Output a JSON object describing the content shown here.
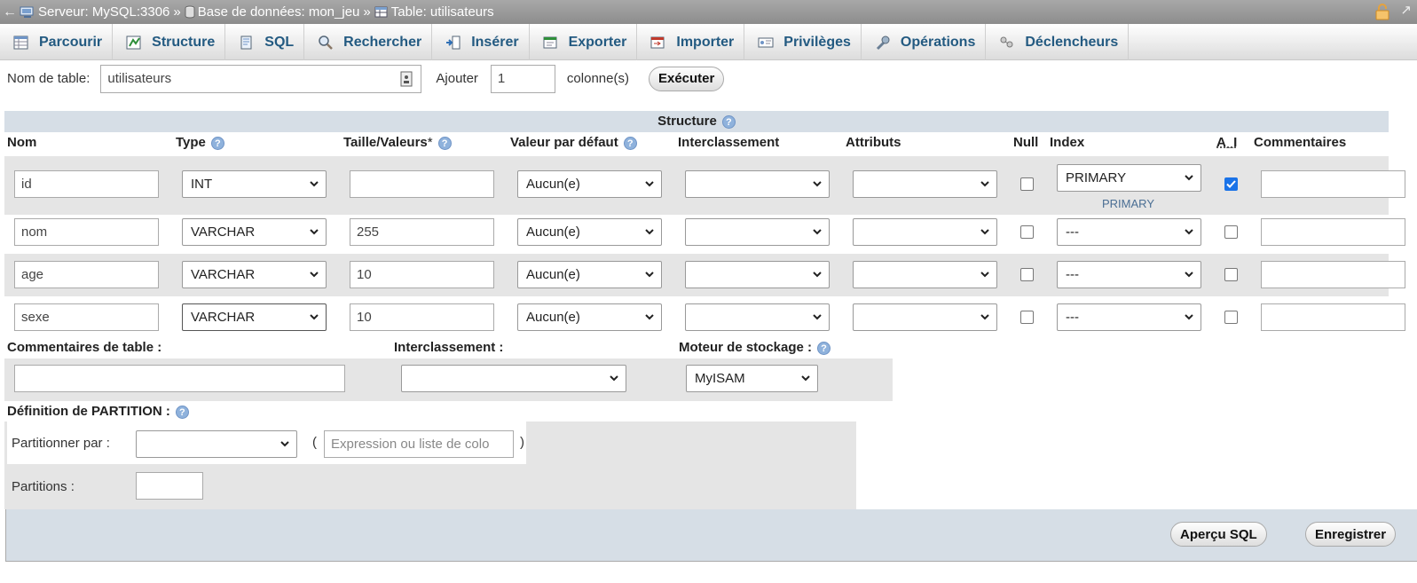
{
  "breadcrumb": {
    "server": "Serveur: MySQL:3306",
    "database": "Base de données: mon_jeu",
    "table": "Table: utilisateurs",
    "sep": "»"
  },
  "tabs": [
    {
      "label": "Parcourir",
      "icon": "browse-icon"
    },
    {
      "label": "Structure",
      "icon": "structure-icon"
    },
    {
      "label": "SQL",
      "icon": "sql-icon"
    },
    {
      "label": "Rechercher",
      "icon": "search-icon"
    },
    {
      "label": "Insérer",
      "icon": "insert-icon"
    },
    {
      "label": "Exporter",
      "icon": "export-icon"
    },
    {
      "label": "Importer",
      "icon": "import-icon"
    },
    {
      "label": "Privilèges",
      "icon": "privileges-icon"
    },
    {
      "label": "Opérations",
      "icon": "wrench-icon"
    },
    {
      "label": "Déclencheurs",
      "icon": "triggers-icon"
    }
  ],
  "table_name": {
    "label": "Nom de table:",
    "value": "utilisateurs",
    "add_label": "Ajouter",
    "add_value": "1",
    "columns_label": "colonne(s)",
    "execute_label": "Exécuter"
  },
  "structure": {
    "title": "Structure",
    "headers": {
      "nom": "Nom",
      "type": "Type",
      "taille": "Taille/Valeurs",
      "taille_mark": "*",
      "defaut": "Valeur par défaut",
      "interclassement": "Interclassement",
      "attributs": "Attributs",
      "null": "Null",
      "index": "Index",
      "ai": "A_I",
      "commentaires": "Commentaires"
    },
    "rows": [
      {
        "name": "id",
        "type": "INT",
        "size": "",
        "default": "Aucun(e)",
        "index": "PRIMARY",
        "index_sub": "PRIMARY",
        "ai": true,
        "null": false
      },
      {
        "name": "nom",
        "type": "VARCHAR",
        "size": "255",
        "default": "Aucun(e)",
        "index": "---",
        "ai": false,
        "null": false
      },
      {
        "name": "age",
        "type": "VARCHAR",
        "size": "10",
        "default": "Aucun(e)",
        "index": "---",
        "ai": false,
        "null": false
      },
      {
        "name": "sexe",
        "type": "VARCHAR",
        "size": "10",
        "default": "Aucun(e)",
        "index": "---",
        "ai": false,
        "null": false
      }
    ]
  },
  "table_options": {
    "comments_label": "Commentaires de table :",
    "collation_label": "Interclassement :",
    "engine_label": "Moteur de stockage :",
    "engine_value": "MyISAM"
  },
  "partition": {
    "title": "Définition de PARTITION :",
    "by_label": "Partitionner par :",
    "expr_placeholder": "Expression ou liste de colo",
    "open_paren": "(",
    "close_paren": ")",
    "partitions_label": "Partitions :"
  },
  "footer": {
    "preview_label": "Aperçu SQL",
    "save_label": "Enregistrer"
  },
  "colors": {
    "tab_text": "#235a81",
    "header_bg": "#d6dee6",
    "row_grey": "#e5e5e5",
    "checkbox_on": "#1a73e8"
  }
}
